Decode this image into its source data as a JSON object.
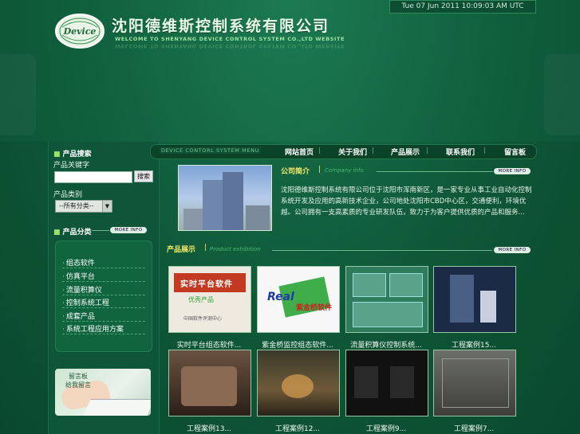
{
  "clock": "Tue 07 Jun 2011 10:09:03 AM UTC",
  "header": {
    "logo_text": "Device",
    "title_cn": "沈阳德维斯控制系统有限公司",
    "subtitle_en": "WELCOME TO SHENYANG DEVICE CONTROL SYSTEM CO.,LTD WEBSITE"
  },
  "sidebar": {
    "search_heading": "产品搜索",
    "keyword_label": "产品关键字",
    "search_button": "搜索",
    "category_label": "产品类别",
    "category_select_value": "--所有分类--",
    "category_heading": "产品分类",
    "more_label": "MORE INFO",
    "categories": [
      "组态软件",
      "仿真平台",
      "流量积算仪",
      "控制系统工程",
      "成套产品",
      "系统工程应用方案"
    ],
    "ad_line1": "留言板",
    "ad_line2": "给我留言"
  },
  "nav": {
    "title": "DEVICE CONTORL SYSTEM  MENU",
    "items": [
      "网站首页",
      "关于我们",
      "产品展示",
      "联系我们",
      "留言板"
    ]
  },
  "company": {
    "title": "公司简介",
    "subtitle": "Company info",
    "more": "MORE INFO",
    "text": "沈阳德维斯控制系统有限公司位于沈阳市浑南新区，是一家专业从事工业自动化控制系统开发及应用的高新技术企业，公司地处沈阳市CBD中心区，交通便利，环境优越。公司拥有一支高素质的专业研发队伍，致力于为客户提供优质的产品和服务..."
  },
  "products": {
    "title": "产品展示",
    "subtitle": "Product exhibition",
    "more": "MORE INFO",
    "items": [
      {
        "caption": "实时平台组态软件..."
      },
      {
        "caption": "紫金桥监控组态软件..."
      },
      {
        "caption": "流量积算仪控制系统..."
      },
      {
        "caption": "工程案例15..."
      },
      {
        "caption": "工程案例13..."
      },
      {
        "caption": "工程案例12..."
      },
      {
        "caption": "工程案例9..."
      },
      {
        "caption": "工程案例7..."
      }
    ],
    "thumb_texts": {
      "t1_banner": "实时平台软件",
      "t1_sub": "优秀产品",
      "t1_small": "中国软件评测中心",
      "t2_brand": "Real",
      "t2_text": "紫金桥软件"
    }
  }
}
